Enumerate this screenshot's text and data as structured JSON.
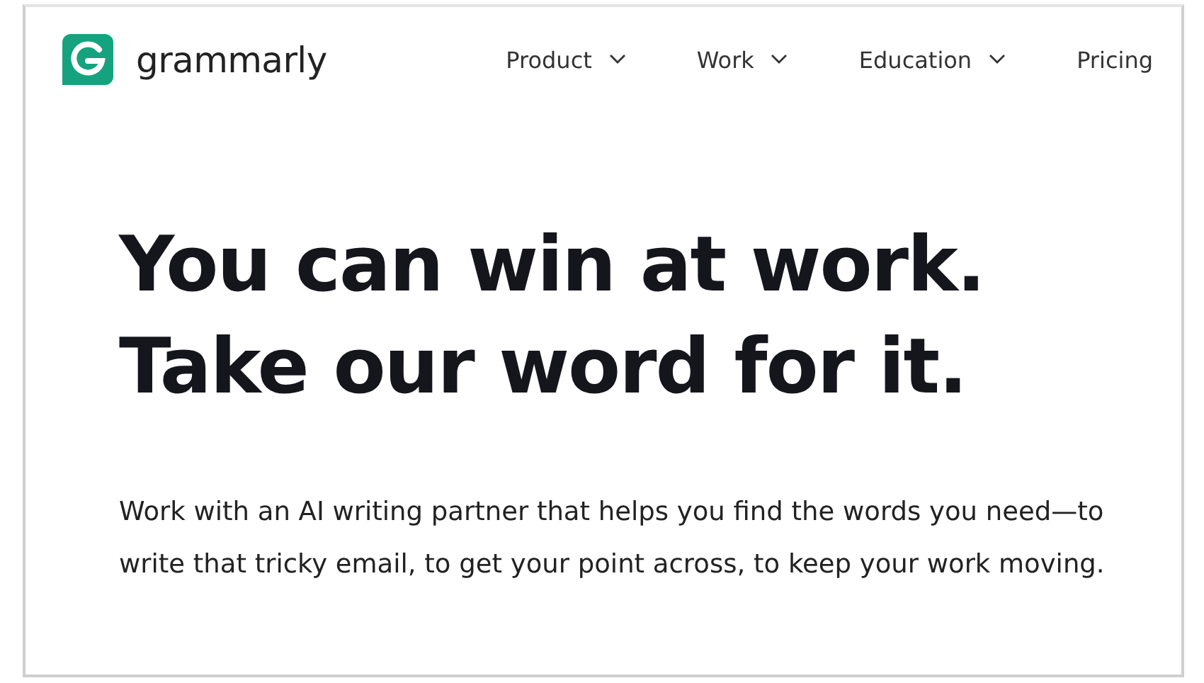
{
  "brand": {
    "name": "grammarly"
  },
  "nav": [
    {
      "label": "Product",
      "dropdown": true
    },
    {
      "label": "Work",
      "dropdown": true
    },
    {
      "label": "Education",
      "dropdown": true
    },
    {
      "label": "Pricing",
      "dropdown": false
    }
  ],
  "hero": {
    "headline": [
      "You can win at work.",
      "Take our word for it."
    ],
    "body": "Work with an AI writing partner that helps you find the words you need—to write that tricky email, to get your point across, to keep your work moving."
  }
}
